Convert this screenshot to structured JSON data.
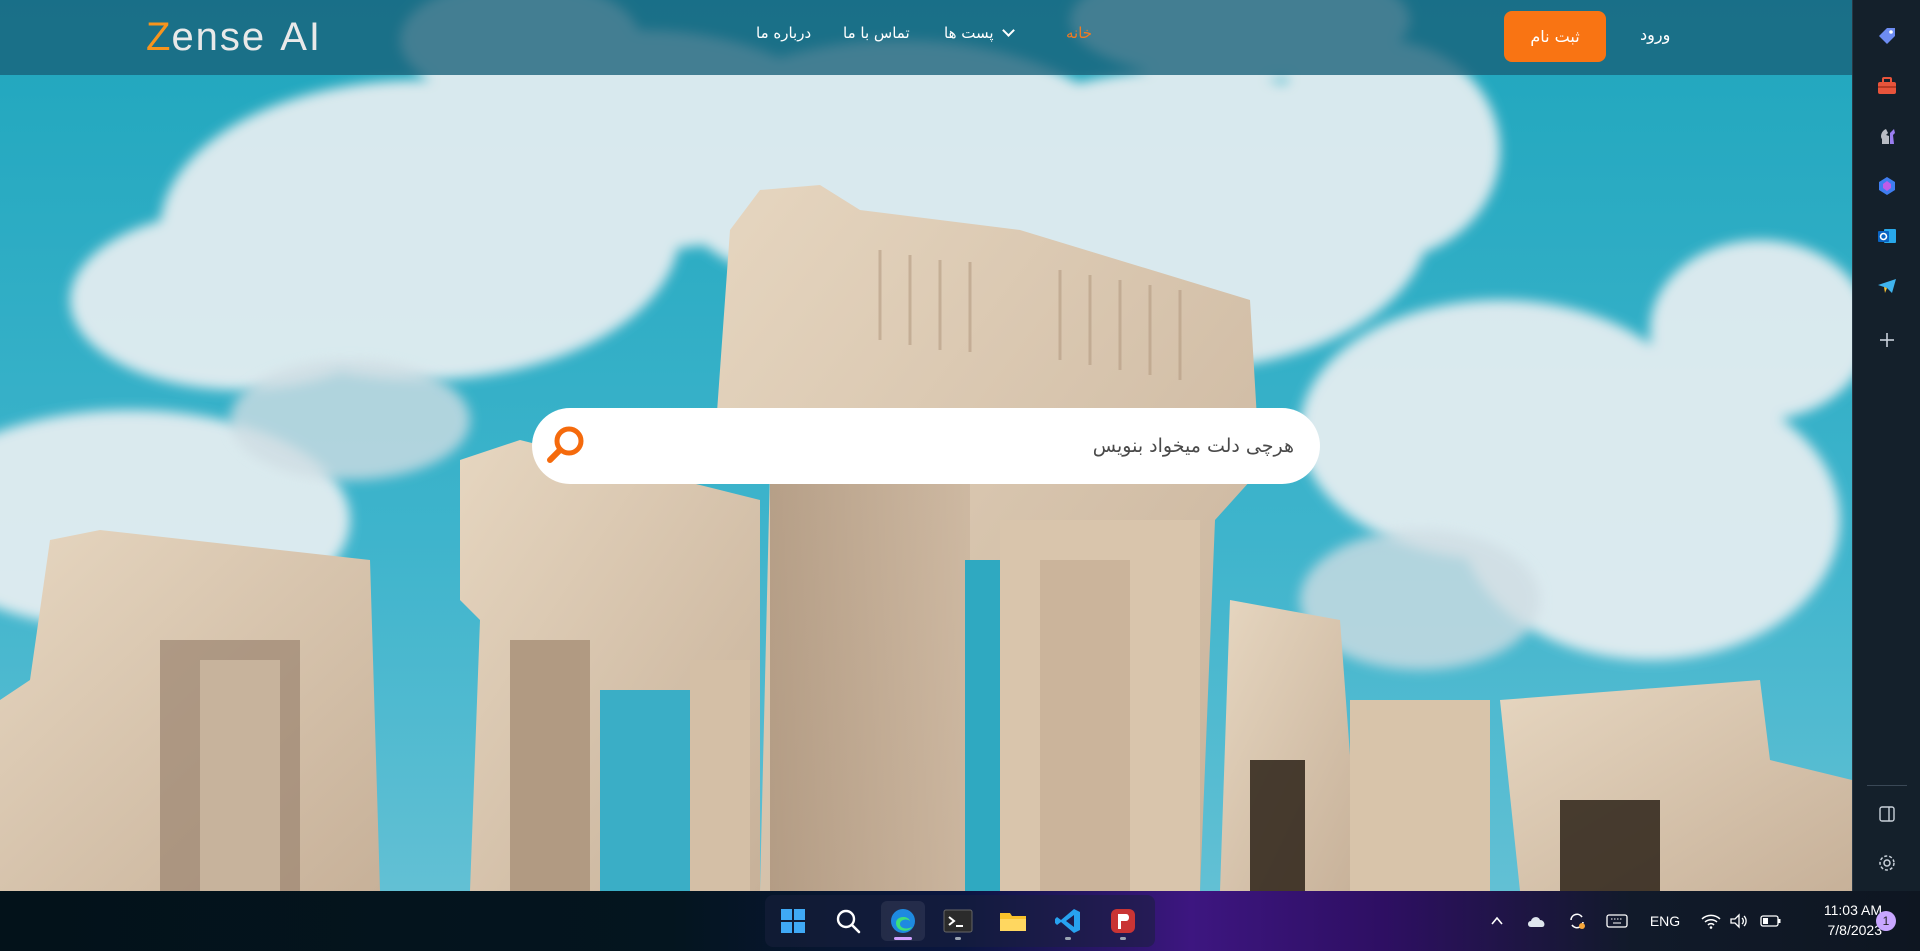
{
  "brand": {
    "logo_z": "Z",
    "logo_rest": "ense",
    "logo_ai": "AI",
    "accent_color": "#f97413"
  },
  "nav": {
    "home": "خانه",
    "posts": "پست ها",
    "contact": "تماس با ما",
    "about": "درباره ما",
    "login": "ورود",
    "signup": "ثبت نام"
  },
  "search": {
    "placeholder": "هرچی دلت میخواد بنویس"
  },
  "sidebar": {
    "items": [
      "tag-icon",
      "briefcase-icon",
      "chess-icon",
      "copilot-icon",
      "outlook-icon",
      "telegram-icon",
      "add-icon"
    ],
    "bottom": [
      "split-screen-icon",
      "settings-icon"
    ]
  },
  "taskbar": {
    "apps": [
      "windows-start-icon",
      "search-icon",
      "edge-icon",
      "terminal-icon",
      "file-explorer-icon",
      "vscode-icon",
      "psiphon-icon"
    ],
    "language": "ENG",
    "time": "11:03 AM",
    "date": "7/8/2023",
    "notification_count": "1"
  }
}
